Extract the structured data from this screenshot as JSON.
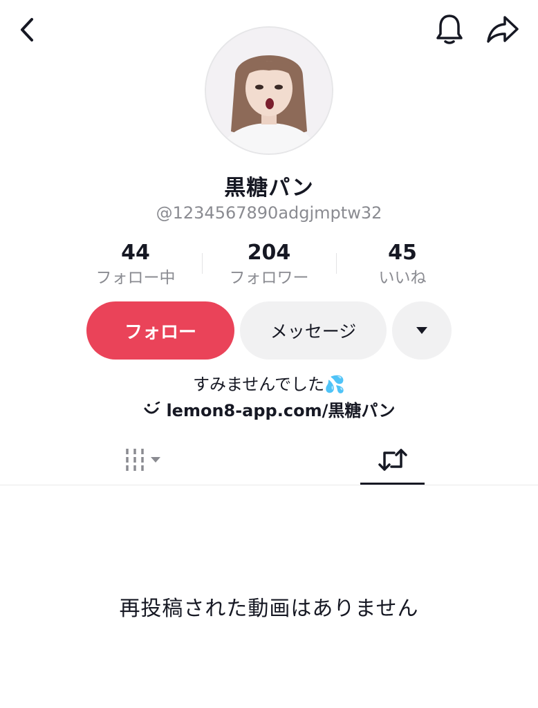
{
  "header": {
    "back_icon": "chevron-left-icon",
    "bell_icon": "bell-icon",
    "share_icon": "share-arrow-icon"
  },
  "profile": {
    "username": "黒糖パン",
    "handle": "@1234567890adgjmptw32",
    "avatar": "profile-photo"
  },
  "stats": [
    {
      "value": "44",
      "label": "フォロー中"
    },
    {
      "value": "204",
      "label": "フォロワー"
    },
    {
      "value": "45",
      "label": "いいね"
    }
  ],
  "actions": {
    "follow_label": "フォロー",
    "message_label": "メッセージ",
    "more_icon": "caret-down-icon"
  },
  "bio": {
    "text": "すみませんでした💦",
    "link_icon": "lemon8-smile-icon",
    "link_text": "lemon8-app.com/黒糖パン"
  },
  "tabs": [
    {
      "name": "videos",
      "icon": "grid-filter-icon",
      "active": false
    },
    {
      "name": "reposts",
      "icon": "repost-icon",
      "active": true
    }
  ],
  "content": {
    "empty_message": "再投稿された動画はありません"
  },
  "colors": {
    "accent": "#ea4359",
    "secondary_button": "#f1f1f2",
    "muted_text": "#8a8b91",
    "primary_text": "#161823"
  }
}
